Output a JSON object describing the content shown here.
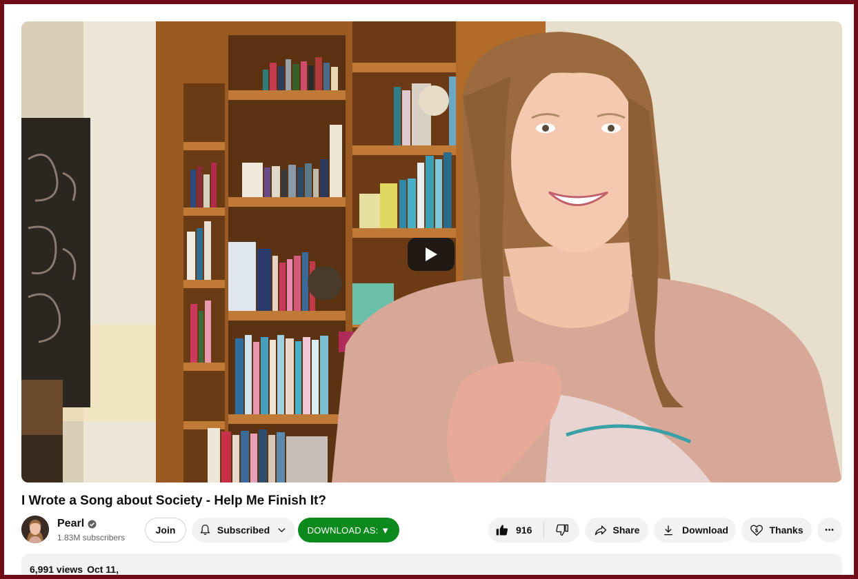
{
  "video": {
    "title": "I Wrote a Song about Society - Help Me Finish It?"
  },
  "channel": {
    "name": "Pearl",
    "subscribers": "1.83M subscribers",
    "verified": true
  },
  "actions": {
    "join_label": "Join",
    "subscribed_label": "Subscribed",
    "download_as_label": "DOWNLOAD AS: ▼",
    "like_count": "916",
    "share_label": "Share",
    "download_label": "Download",
    "thanks_label": "Thanks",
    "more_glyph": "•••"
  },
  "description": {
    "views": "6,991 views",
    "date": "Oct 11,"
  },
  "icons": [
    "play-icon",
    "verified-check-icon",
    "bell-icon",
    "chevron-down-icon",
    "thumbs-up-icon",
    "thumbs-down-icon",
    "share-arrow-icon",
    "download-icon",
    "thanks-heart-icon",
    "more-icon"
  ],
  "colors": {
    "outer_border": "#6e0d17",
    "download_as_bg": "#0c8a1d",
    "pill_bg": "#f2f2f2"
  }
}
